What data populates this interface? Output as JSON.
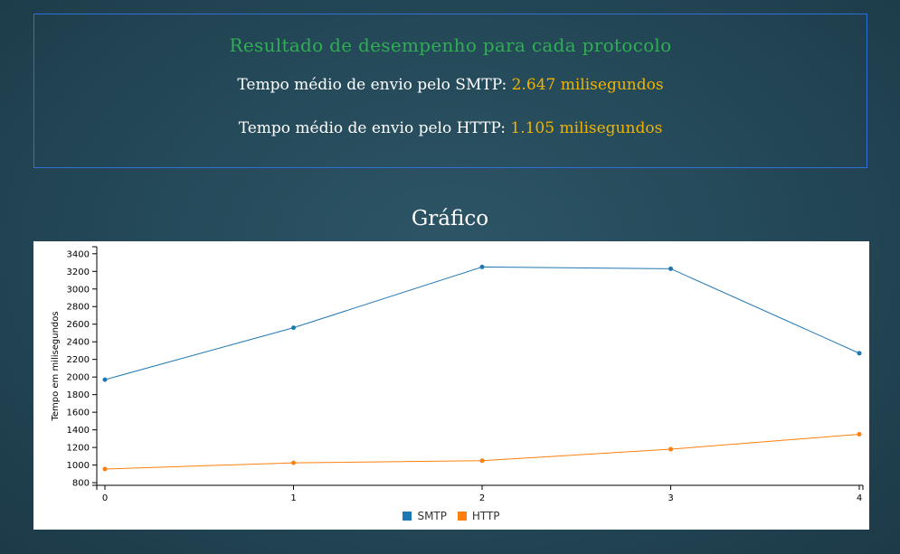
{
  "results": {
    "title": "Resultado de desempenho para cada protocolo",
    "smtp_label": "Tempo médio de envio pelo SMTP:",
    "smtp_value": "2.647 milisegundos",
    "http_label": "Tempo médio de envio pelo HTTP:",
    "http_value": "1.105 milisegundos"
  },
  "chart_heading": "Gráfico",
  "chart_data": {
    "type": "line",
    "x": [
      0,
      1,
      2,
      3,
      4
    ],
    "xticks": [
      "0",
      "1",
      "2",
      "3",
      "4"
    ],
    "ylabel": "Tempo em milisegundos",
    "xlabel": "",
    "ylim": [
      770,
      3480
    ],
    "yticks": [
      800,
      1000,
      1200,
      1400,
      1600,
      1800,
      2000,
      2200,
      2400,
      2600,
      2800,
      3000,
      3200,
      3400
    ],
    "grid": false,
    "legend_position": "bottom-center",
    "series": [
      {
        "name": "SMTP",
        "color": "#1f77b4",
        "values": [
          1970,
          2560,
          3250,
          3230,
          2270
        ]
      },
      {
        "name": "HTTP",
        "color": "#ff7f0e",
        "values": [
          955,
          1025,
          1050,
          1180,
          1350
        ]
      }
    ]
  },
  "colors": {
    "title_green": "#2fae52",
    "value_yellow": "#f0b400",
    "box_border": "#2f6fd6"
  }
}
